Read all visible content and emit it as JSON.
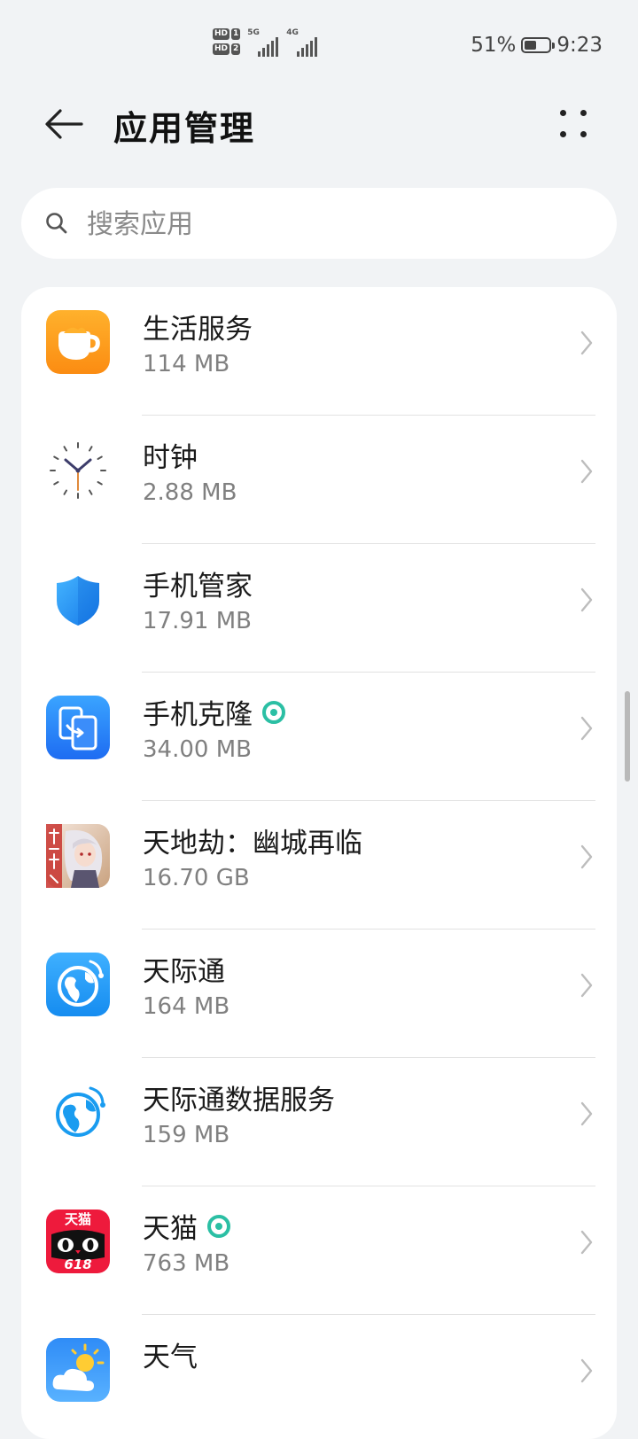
{
  "status_bar": {
    "hd1": "HD",
    "hd1_slot": "1",
    "hd2": "HD",
    "hd2_slot": "2",
    "net1": "5G",
    "net2": "4G",
    "battery_percent": "51%",
    "battery_level": 0.51,
    "time": "9:23"
  },
  "header": {
    "title": "应用管理"
  },
  "search": {
    "placeholder": "搜索应用"
  },
  "apps": [
    {
      "name": "生活服务",
      "size": "114 MB",
      "icon": "coffee-cup-icon"
    },
    {
      "name": "时钟",
      "size": "2.88 MB",
      "icon": "clock-icon"
    },
    {
      "name": "手机管家",
      "size": "17.91 MB",
      "icon": "shield-icon"
    },
    {
      "name": "手机克隆",
      "size": "34.00 MB",
      "icon": "phone-clone-icon",
      "badge": "harmony-badge-icon"
    },
    {
      "name": "天地劫：幽城再临",
      "size": "16.70 GB",
      "icon": "game-character-icon"
    },
    {
      "name": "天际通",
      "size": "164 MB",
      "icon": "globe-icon"
    },
    {
      "name": "天际通数据服务",
      "size": "159 MB",
      "icon": "globe-outline-icon"
    },
    {
      "name": "天猫",
      "size": "763 MB",
      "icon": "tmall-icon",
      "badge": "harmony-badge-icon",
      "icon_text": "天猫",
      "icon_sub": "618"
    },
    {
      "name": "天气",
      "size": "",
      "icon": "weather-icon"
    }
  ],
  "colors": {
    "background": "#f1f3f5",
    "card": "#ffffff",
    "accent_blue": "#1f8fff",
    "badge_teal": "#2bbfa4"
  }
}
